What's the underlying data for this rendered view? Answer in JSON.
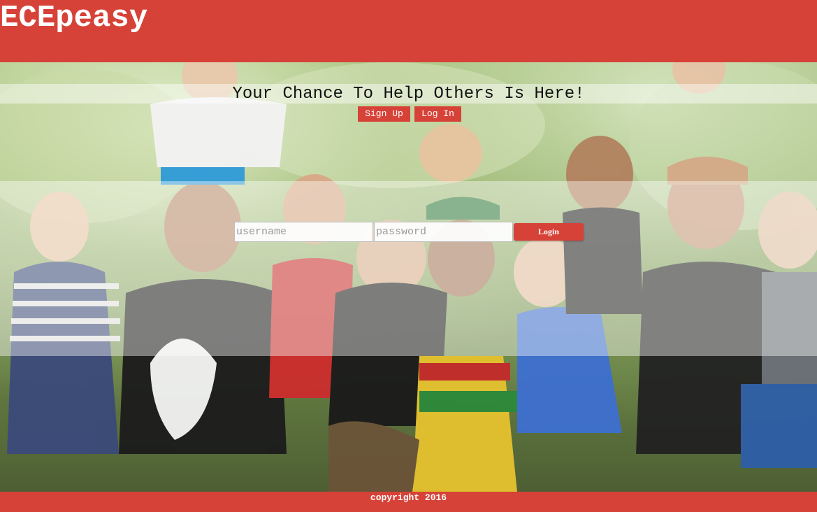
{
  "header": {
    "brand": "ECEpeasy"
  },
  "hero": {
    "tagline": "Your Chance To Help Others Is Here!",
    "signup_label": "Sign Up",
    "login_label": "Log In"
  },
  "login_form": {
    "username_placeholder": "username",
    "username_value": "",
    "password_placeholder": "password",
    "password_value": "",
    "submit_label": "Login"
  },
  "footer": {
    "copyright": "copyright 2016"
  },
  "colors": {
    "brand_red": "#d64238",
    "text_on_brand": "#ffffff"
  }
}
